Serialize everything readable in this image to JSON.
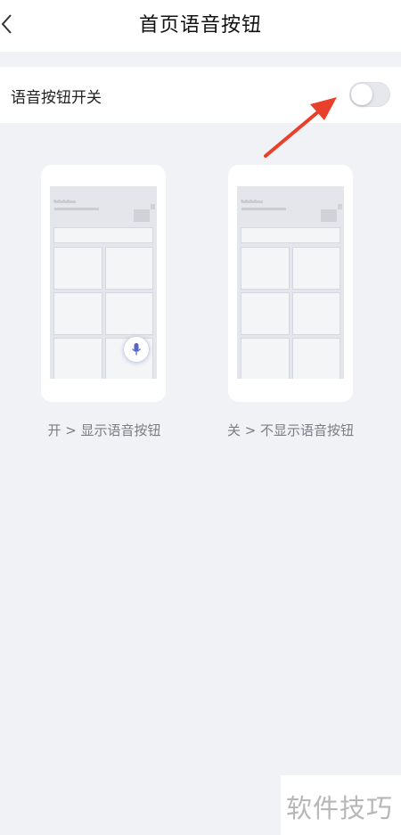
{
  "header": {
    "title": "首页语音按钮"
  },
  "setting": {
    "label": "语音按钮开关",
    "enabled": false
  },
  "previews": [
    {
      "caption": "开 > 显示语音按钮",
      "show_mic": true
    },
    {
      "caption": "关 > 不显示语音按钮",
      "show_mic": false
    }
  ],
  "watermark": {
    "text": "软件技巧"
  },
  "colors": {
    "annotation_arrow": "#e8402a",
    "mic_icon": "#5a63c8"
  }
}
